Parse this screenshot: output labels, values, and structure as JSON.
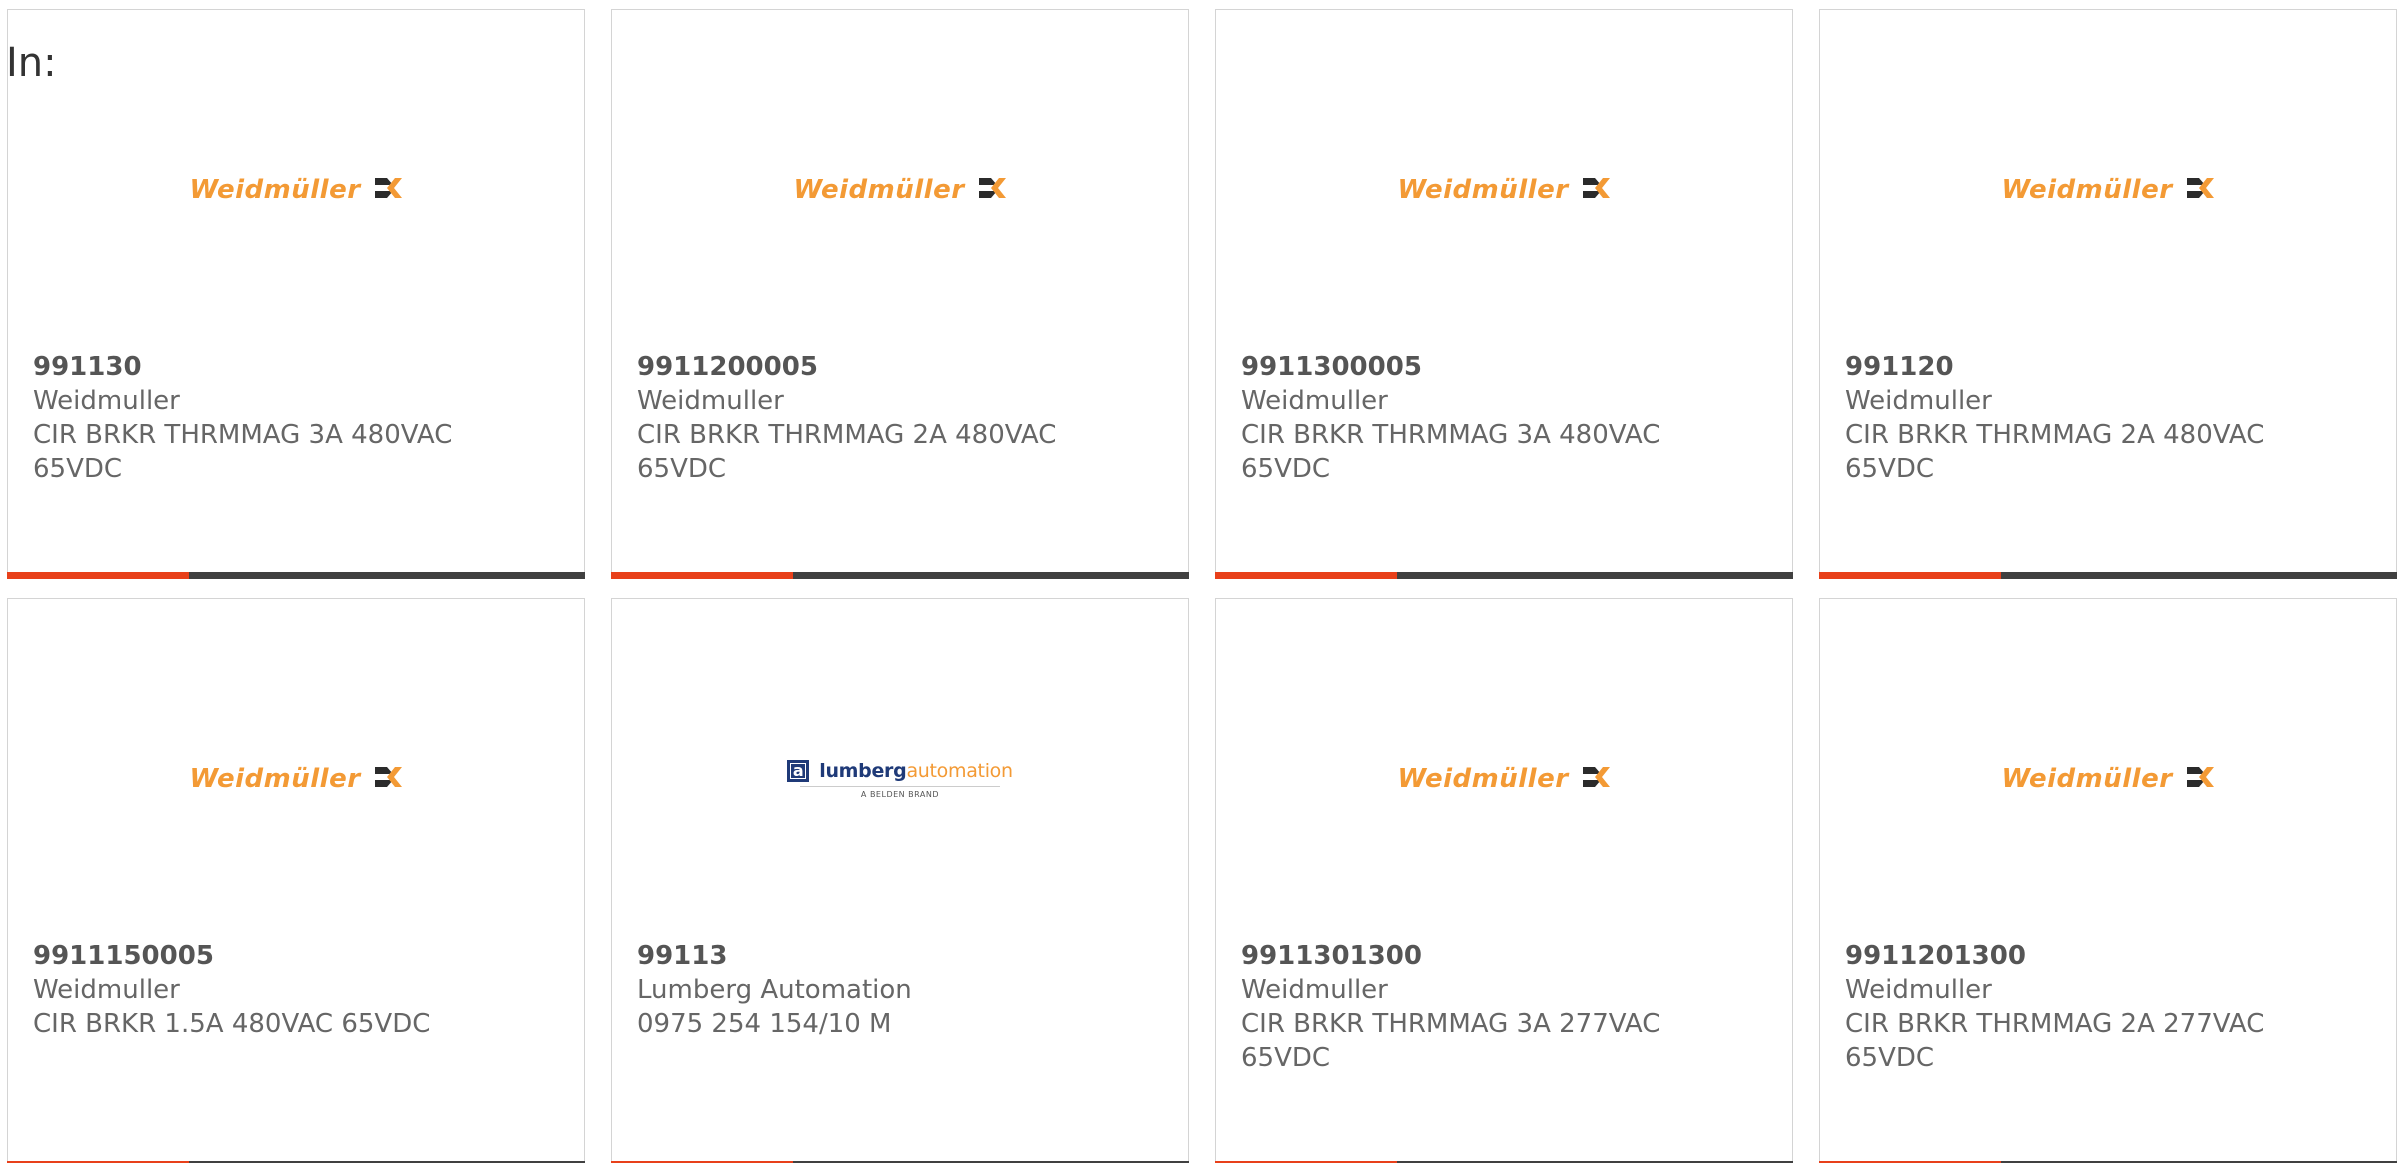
{
  "header": {
    "in_label": "In:"
  },
  "colors": {
    "accent": "#e8401a",
    "bar_dark": "#404040",
    "weidmuller_orange": "#f39a35",
    "lumberg_blue": "#1f3a78"
  },
  "brands": {
    "weidmuller": {
      "wordmark": "Weidmüller",
      "icon": "weidmuller-logo-icon"
    },
    "lumberg": {
      "wordmark_a": "lumberg",
      "wordmark_b": "automation",
      "tagline": "A BELDEN BRAND",
      "icon": "lumberg-logo-icon"
    }
  },
  "products": [
    {
      "part_number": "991130",
      "manufacturer": "Weidmuller",
      "description": "CIR BRKR THRMMAG 3A 480VAC 65VDC",
      "brand": "weidmuller"
    },
    {
      "part_number": "9911200005",
      "manufacturer": "Weidmuller",
      "description": "CIR BRKR THRMMAG 2A 480VAC 65VDC",
      "brand": "weidmuller"
    },
    {
      "part_number": "9911300005",
      "manufacturer": "Weidmuller",
      "description": "CIR BRKR THRMMAG 3A 480VAC 65VDC",
      "brand": "weidmuller"
    },
    {
      "part_number": "991120",
      "manufacturer": "Weidmuller",
      "description": "CIR BRKR THRMMAG 2A 480VAC 65VDC",
      "brand": "weidmuller"
    },
    {
      "part_number": "9911150005",
      "manufacturer": "Weidmuller",
      "description": "CIR BRKR 1.5A 480VAC 65VDC",
      "brand": "weidmuller"
    },
    {
      "part_number": "99113",
      "manufacturer": "Lumberg Automation",
      "description": "0975 254 154/10 M",
      "brand": "lumberg"
    },
    {
      "part_number": "9911301300",
      "manufacturer": "Weidmuller",
      "description": "CIR BRKR THRMMAG 3A 277VAC 65VDC",
      "brand": "weidmuller"
    },
    {
      "part_number": "9911201300",
      "manufacturer": "Weidmuller",
      "description": "CIR BRKR THRMMAG 2A 277VAC 65VDC",
      "brand": "weidmuller"
    }
  ]
}
